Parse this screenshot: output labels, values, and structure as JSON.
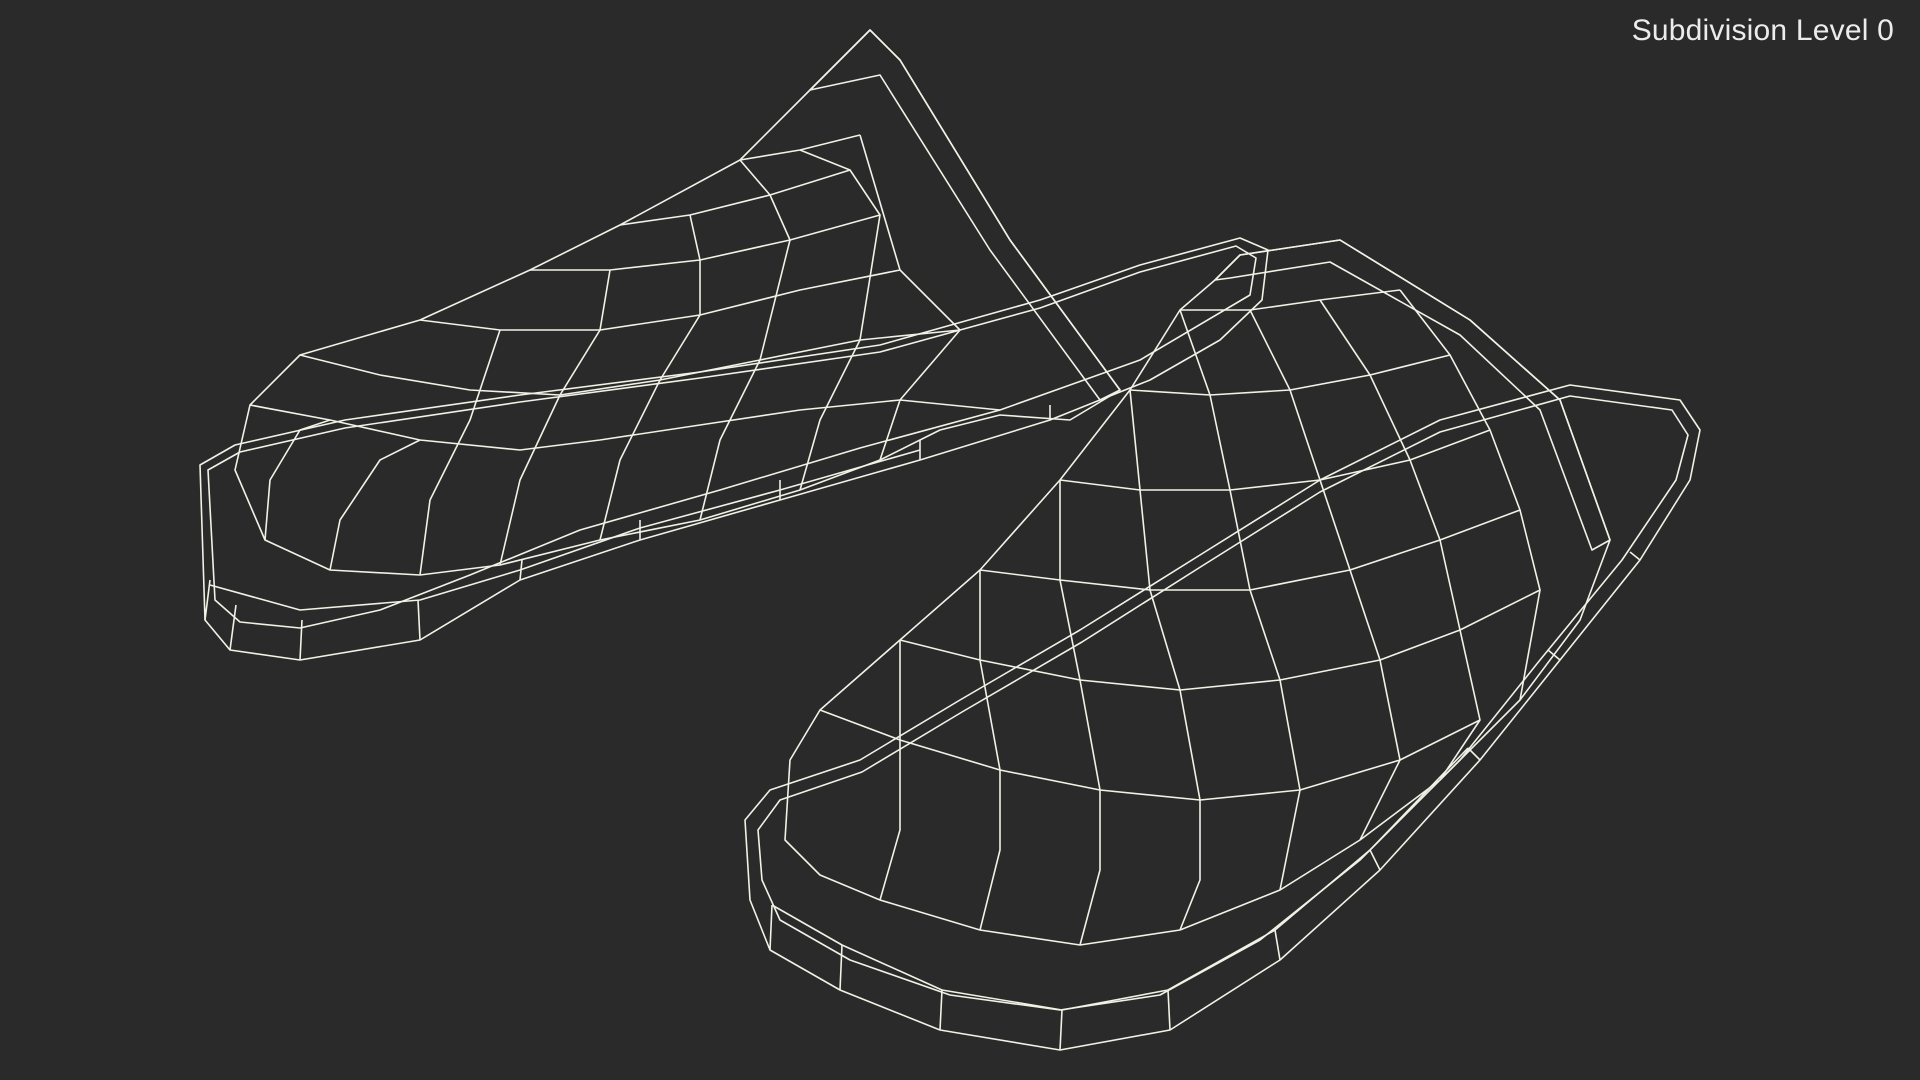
{
  "viewport": {
    "overlay_label": "Subdivision Level 0",
    "background_color": "#2a2a2a"
  },
  "model": {
    "subject": "pair of slippers",
    "display_mode": "shaded wireframe",
    "surface_color": "#7c7d71",
    "wire_color": "#f1f1e6"
  }
}
